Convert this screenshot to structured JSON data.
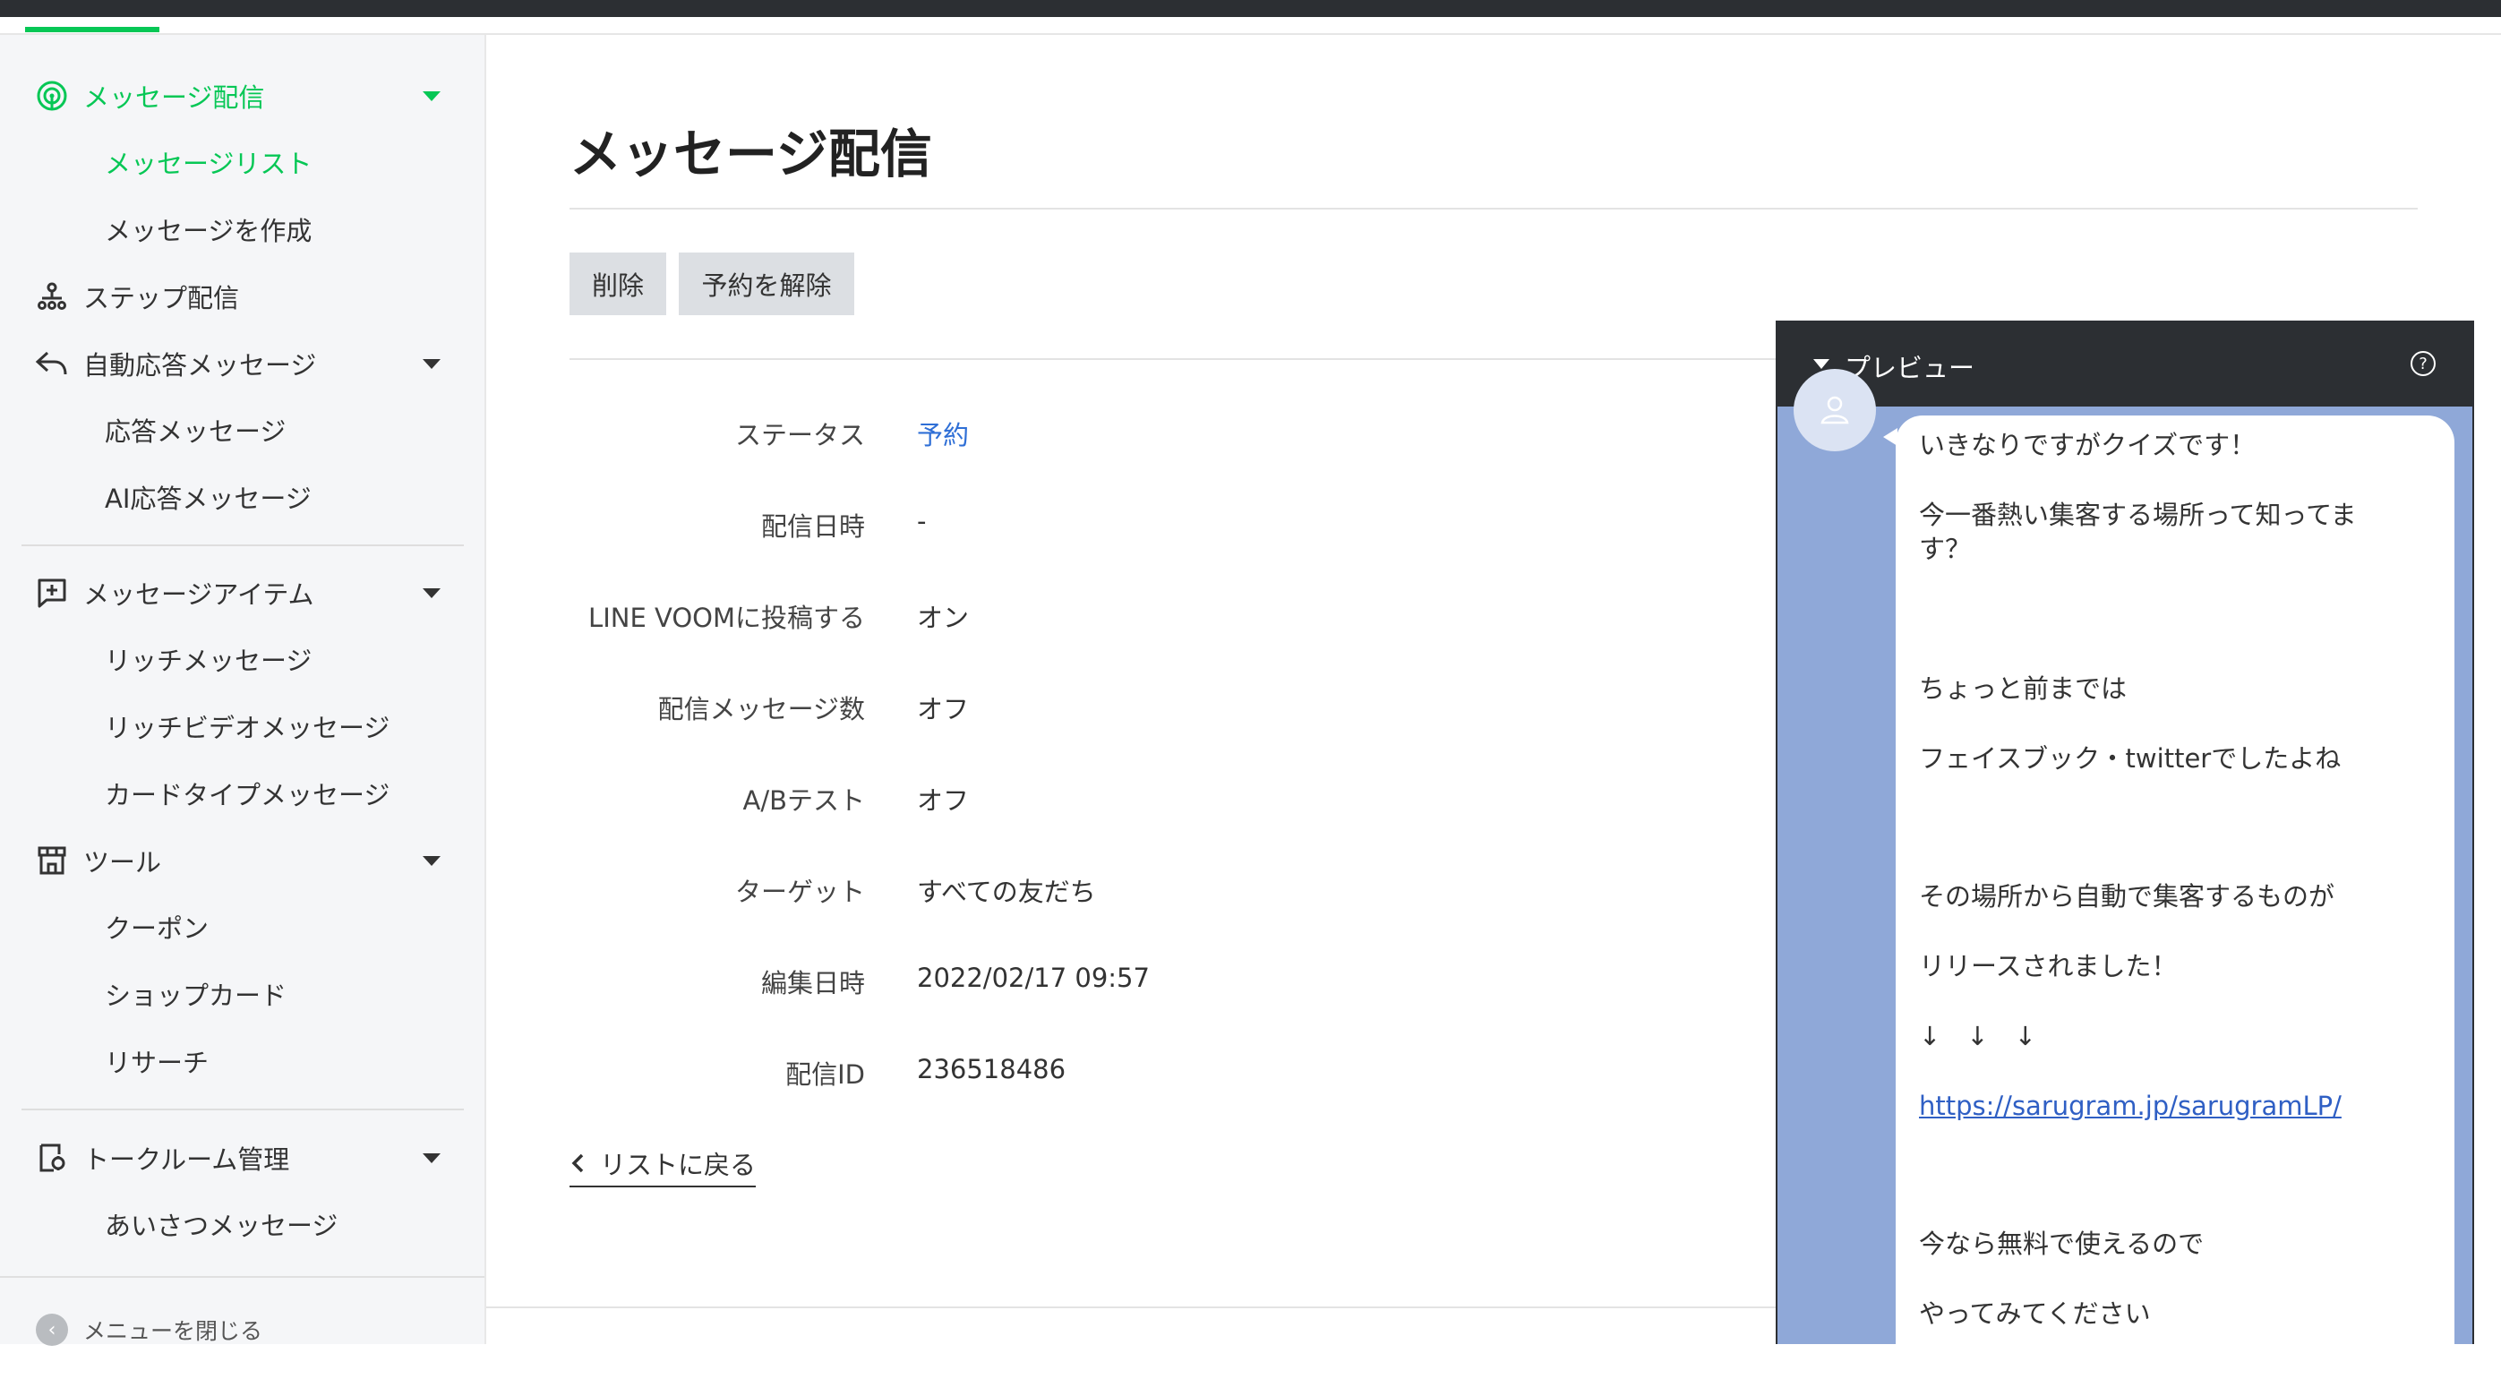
{
  "sidebar": {
    "sections": [
      {
        "label": "メッセージ配信",
        "icon": "broadcast-icon"
      },
      {
        "label": "ステップ配信",
        "icon": "step-tree-icon"
      },
      {
        "label": "自動応答メッセージ",
        "icon": "reply-icon"
      },
      {
        "label": "メッセージアイテム",
        "icon": "add-message-icon"
      },
      {
        "label": "ツール",
        "icon": "shop-icon"
      },
      {
        "label": "トークルーム管理",
        "icon": "talkroom-icon"
      }
    ],
    "sub": {
      "message_list": "メッセージリスト",
      "create_message": "メッセージを作成",
      "reply_message": "応答メッセージ",
      "ai_reply": "AI応答メッセージ",
      "rich_message": "リッチメッセージ",
      "rich_video": "リッチビデオメッセージ",
      "card_type": "カードタイプメッセージ",
      "coupon": "クーポン",
      "shop_card": "ショップカード",
      "research": "リサーチ",
      "greeting": "あいさつメッセージ"
    },
    "collapse_label": "メニューを閉じる",
    "accent_color": "#06c755"
  },
  "main": {
    "title": "メッセージ配信",
    "buttons": {
      "delete": "削除",
      "unschedule": "予約を解除"
    },
    "details": [
      {
        "label": "ステータス",
        "value": "予約"
      },
      {
        "label": "配信日時",
        "value": "-"
      },
      {
        "label": "LINE VOOMに投稿する",
        "value": "オン"
      },
      {
        "label": "配信メッセージ数",
        "value": "オフ"
      },
      {
        "label": "A/Bテスト",
        "value": "オフ"
      },
      {
        "label": "ターゲット",
        "value": "すべての友だち"
      },
      {
        "label": "編集日時",
        "value": "2022/02/17 09:57"
      },
      {
        "label": "配信ID",
        "value": "236518486"
      }
    ],
    "back_link": "リストに戻る"
  },
  "preview": {
    "title": "プレビュー",
    "help": "?",
    "lines": [
      "いきなりですがクイズです！",
      "今一番熱い集客する場所って知ってま",
      "す？",
      "ちょっと前までは",
      "フェイスブック・twitterでしたよね",
      "その場所から自動で集客するものが",
      "リリースされました！",
      "↓　↓　↓",
      "https://sarugram.jp/sarugramLP/",
      "今なら無料で使えるので",
      "やってみてください"
    ]
  }
}
